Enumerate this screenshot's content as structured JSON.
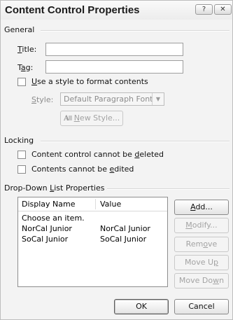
{
  "window": {
    "title": "Content Control Properties",
    "help_glyph": "?",
    "close_glyph": "✕"
  },
  "general": {
    "heading": "General",
    "title_label_ul": "T",
    "title_label_rest": "itle:",
    "title_value": "",
    "tag_label_pre": "T",
    "tag_label_ul": "a",
    "tag_label_rest": "g:",
    "tag_value": "",
    "use_style_ul": "U",
    "use_style_rest": "se a style to format contents",
    "use_style_checked": false,
    "style_label_ul": "S",
    "style_label_rest": "tyle:",
    "style_value": "Default Paragraph Font",
    "new_style_ul": "N",
    "new_style_rest": "ew Style..."
  },
  "locking": {
    "heading": "Locking",
    "cannot_delete_pre": "Content control cannot be ",
    "cannot_delete_ul": "d",
    "cannot_delete_rest": "eleted",
    "cannot_delete_checked": false,
    "cannot_edit_pre": "Contents cannot be ",
    "cannot_edit_ul": "e",
    "cannot_edit_rest": "dited",
    "cannot_edit_checked": false
  },
  "dropdown": {
    "heading_pre": "Drop-Down ",
    "heading_ul": "L",
    "heading_rest": "ist Properties",
    "columns": {
      "display_name": "Display Name",
      "value": "Value"
    },
    "rows": [
      {
        "display": "Choose an item.",
        "value": ""
      },
      {
        "display": "NorCal Junior",
        "value": "NorCal Junior"
      },
      {
        "display": "SoCal Junior",
        "value": "SoCal Junior"
      }
    ],
    "buttons": {
      "add_ul": "A",
      "add_rest": "dd...",
      "modify_ul": "M",
      "modify_rest": "odify...",
      "remove_pre": "Rem",
      "remove_ul": "o",
      "remove_rest": "ve",
      "move_up_pre": "Move U",
      "move_up_ul": "p",
      "move_up_rest": "",
      "move_down_pre": "Move Do",
      "move_down_ul": "w",
      "move_down_rest": "n"
    }
  },
  "footer": {
    "ok_label": "OK",
    "cancel_label": "Cancel"
  }
}
